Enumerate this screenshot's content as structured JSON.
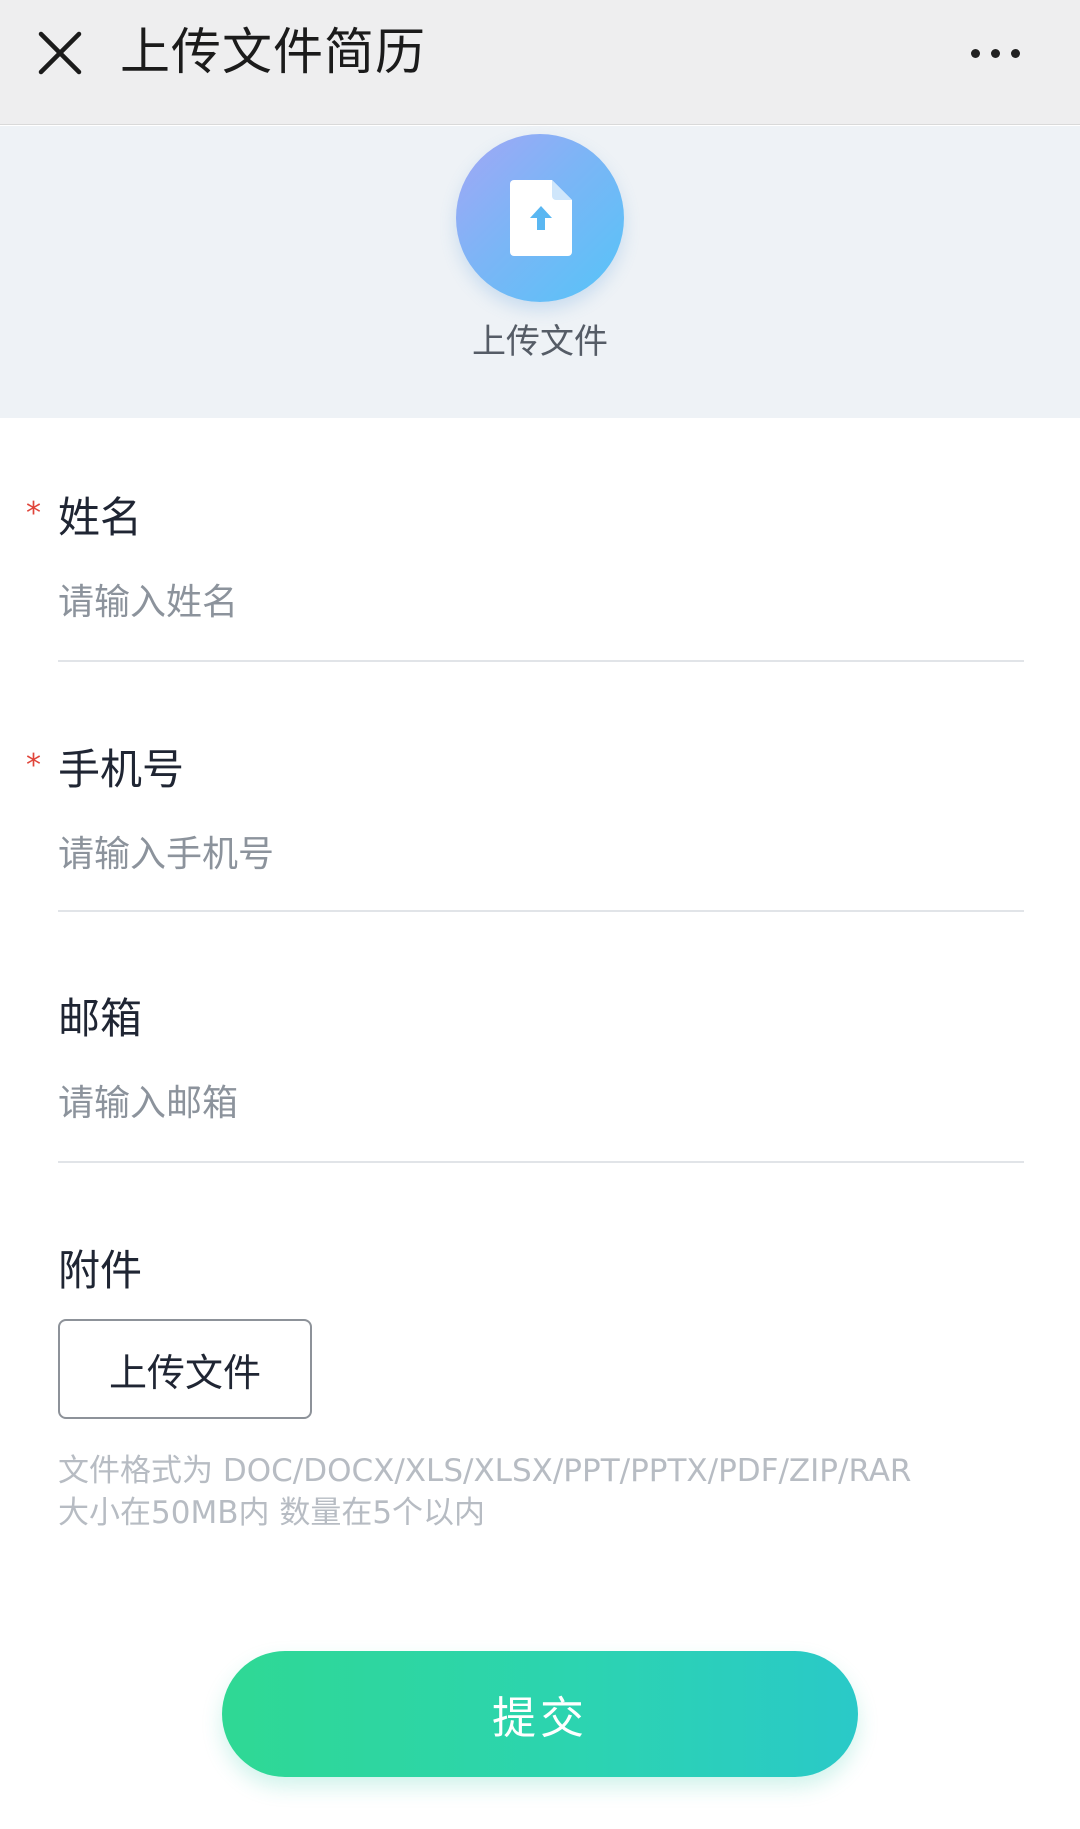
{
  "header": {
    "close_icon": "close-icon",
    "title": "上传文件简历",
    "more_icon": "more-horizontal-icon"
  },
  "upload_banner": {
    "icon": "file-upload-icon",
    "label": "上传文件"
  },
  "form": {
    "required_mark": "*",
    "name": {
      "label": "姓名",
      "placeholder": "请输入姓名",
      "value": "",
      "required": true
    },
    "phone": {
      "label": "手机号",
      "placeholder": "请输入手机号",
      "value": "",
      "required": true
    },
    "email": {
      "label": "邮箱",
      "placeholder": "请输入邮箱",
      "value": "",
      "required": false
    },
    "attachment": {
      "label": "附件",
      "button_label": "上传文件",
      "hint_line1": "文件格式为 DOC/DOCX/XLS/XLSX/PPT/PPTX/PDF/ZIP/RAR",
      "hint_line2": "大小在50MB内 数量在5个以内"
    }
  },
  "submit": {
    "label": "提交"
  },
  "colors": {
    "required_star": "#e0453a",
    "upload_circle_start": "#a3a6f5",
    "upload_circle_end": "#55c4f8",
    "submit_start": "#2fd894",
    "submit_end": "#2ac9c8"
  }
}
